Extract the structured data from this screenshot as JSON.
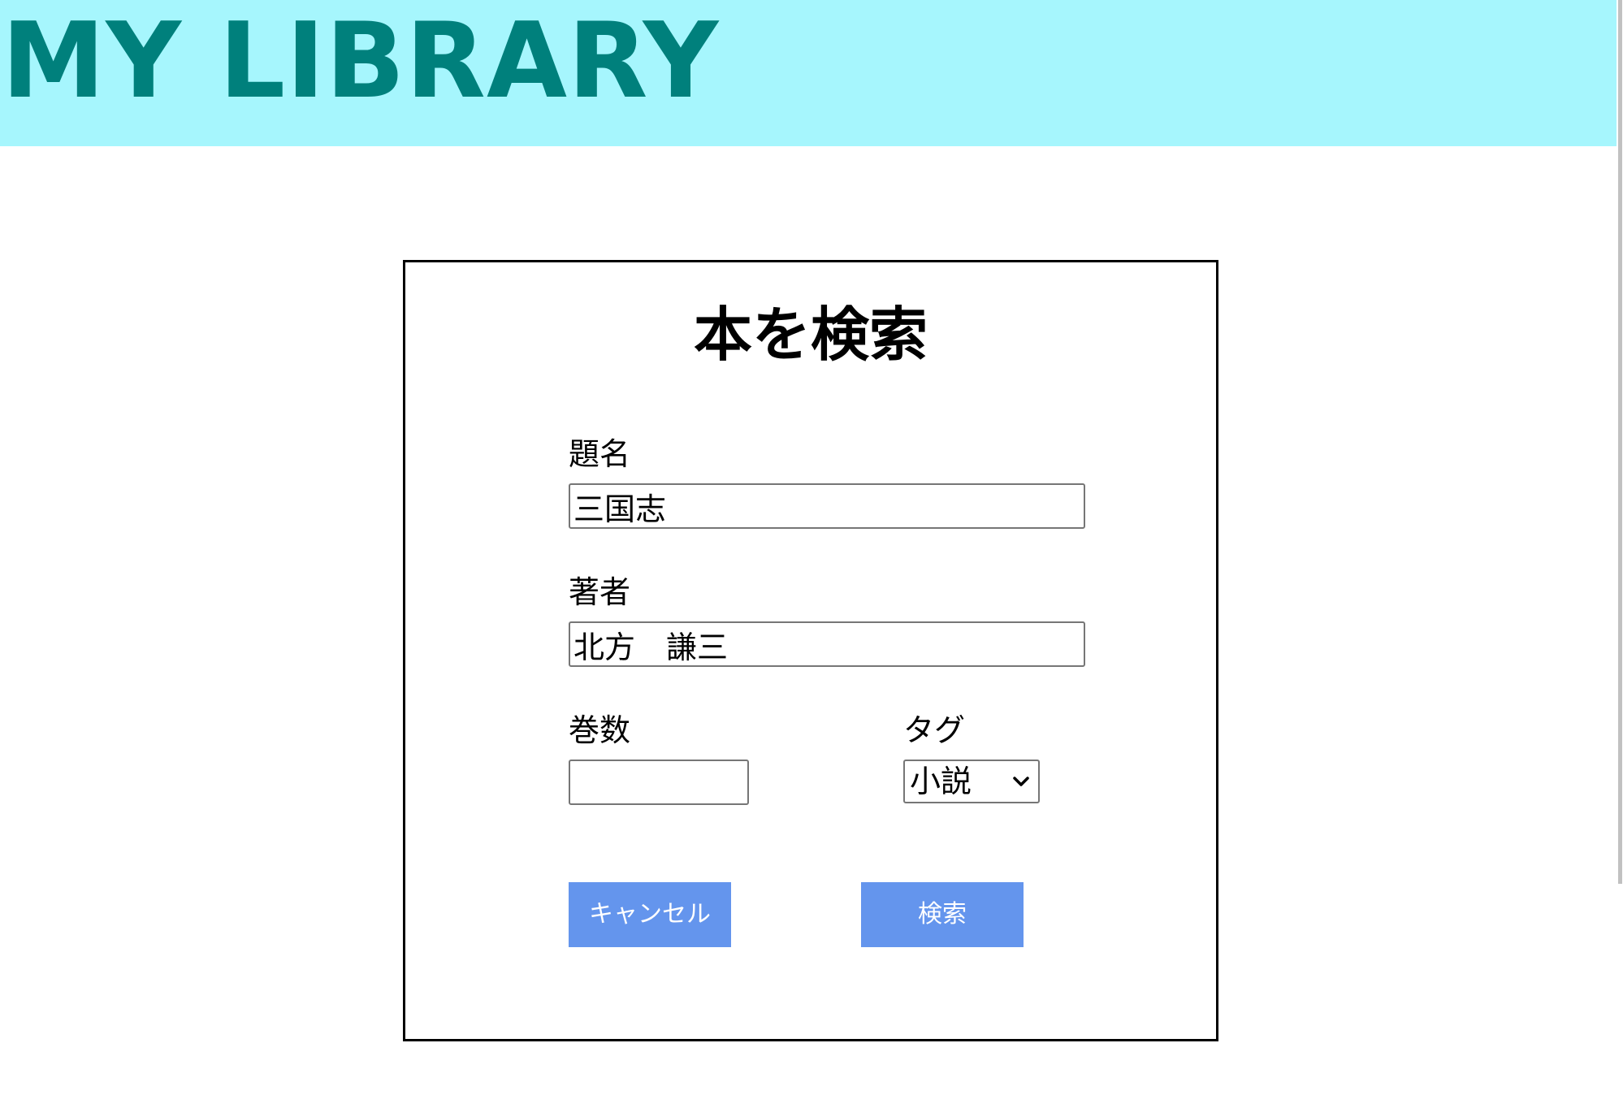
{
  "header": {
    "title": "MY LIBRARY",
    "background": "#a6f6fd",
    "title_color": "#00807c"
  },
  "search_form": {
    "heading": "本を検索",
    "title_field": {
      "label": "題名",
      "value": "三国志"
    },
    "author_field": {
      "label": "著者",
      "value": "北方　謙三"
    },
    "volume_field": {
      "label": "巻数",
      "value": ""
    },
    "tag_field": {
      "label": "タグ",
      "selected": "小説",
      "icon": "chevron-down-icon"
    },
    "buttons": {
      "cancel_label": "キャンセル",
      "search_label": "検索",
      "color": "#6495ed"
    }
  }
}
